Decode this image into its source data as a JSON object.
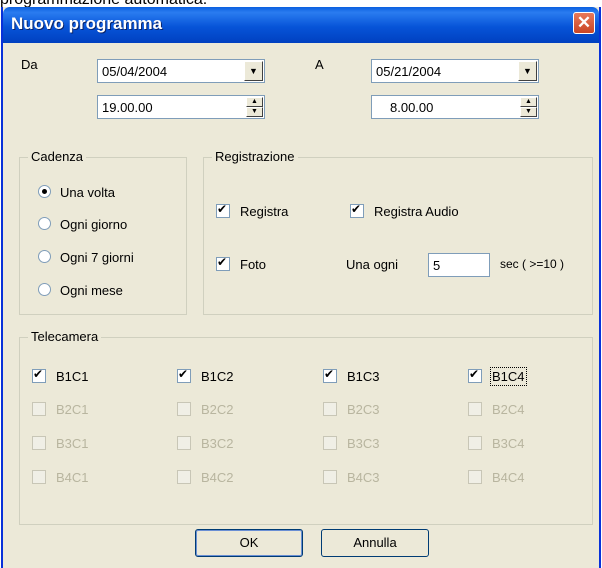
{
  "top_text": "programmazione automatica.",
  "window": {
    "title": "Nuovo programma",
    "close_label": "✕"
  },
  "from": {
    "label": "Da",
    "date": "05/04/2004",
    "time": "19.00.00"
  },
  "to": {
    "label": "A",
    "date": "05/21/2004",
    "time": "8.00.00"
  },
  "cadenza": {
    "legend": "Cadenza",
    "options": [
      "Una volta",
      "Ogni giorno",
      "Ogni 7 giorni",
      "Ogni mese"
    ],
    "selected": "Una volta"
  },
  "registrazione": {
    "legend": "Registrazione",
    "registra": "Registra",
    "registra_audio": "Registra Audio",
    "foto": "Foto",
    "una_ogni": "Una ogni",
    "interval": "5",
    "sec_hint": "sec ( >=10 )"
  },
  "telecamera": {
    "legend": "Telecamera",
    "rows": [
      [
        "B1C1",
        "B1C2",
        "B1C3",
        "B1C4"
      ],
      [
        "B2C1",
        "B2C2",
        "B2C3",
        "B2C4"
      ],
      [
        "B3C1",
        "B3C2",
        "B3C3",
        "B3C4"
      ],
      [
        "B4C1",
        "B4C2",
        "B4C3",
        "B4C4"
      ]
    ]
  },
  "buttons": {
    "ok": "OK",
    "cancel": "Annulla"
  },
  "icons": {
    "dropdown": "chevron-down-icon",
    "spin_up": "spin-up-icon",
    "spin_down": "spin-down-icon",
    "close": "close-icon"
  }
}
